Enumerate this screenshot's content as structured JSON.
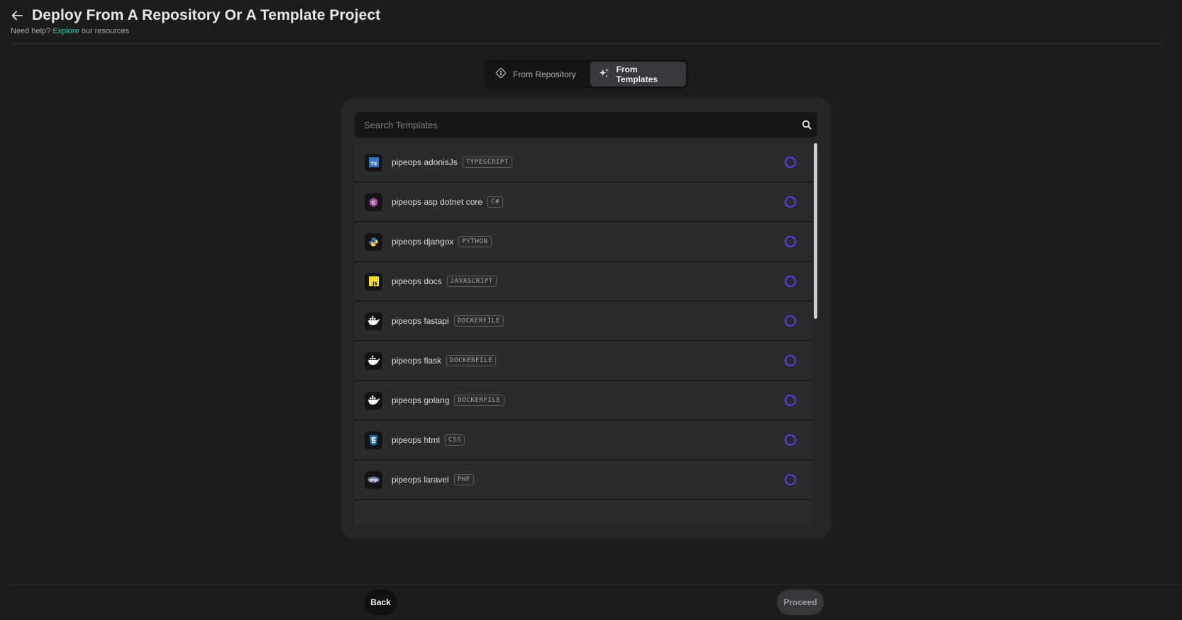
{
  "header": {
    "title": "Deploy From A Repository Or A Template Project",
    "help_prefix": "Need help?",
    "help_link": "Explore",
    "help_suffix": "our resources"
  },
  "tabs": {
    "repository": {
      "label": "From Repository",
      "icon": "git-icon"
    },
    "templates": {
      "label": "From Templates",
      "icon": "sparkles-icon",
      "selected": true
    }
  },
  "search": {
    "placeholder": "Search Templates",
    "value": "",
    "icon": "search-icon"
  },
  "templates": [
    {
      "name": "pipeops adonisJs",
      "tag": "TYPESCRIPT",
      "icon": "typescript-icon"
    },
    {
      "name": "pipeops asp dotnet core",
      "tag": "C#",
      "icon": "csharp-icon"
    },
    {
      "name": "pipeops djangox",
      "tag": "PYTHON",
      "icon": "python-icon"
    },
    {
      "name": "pipeops docs",
      "tag": "JAVASCRIPT",
      "icon": "javascript-icon"
    },
    {
      "name": "pipeops fastapi",
      "tag": "DOCKERFILE",
      "icon": "docker-icon"
    },
    {
      "name": "pipeops flask",
      "tag": "DOCKERFILE",
      "icon": "docker-icon"
    },
    {
      "name": "pipeops golang",
      "tag": "DOCKERFILE",
      "icon": "docker-icon"
    },
    {
      "name": "pipeops html",
      "tag": "CSS",
      "icon": "css3-icon"
    },
    {
      "name": "pipeops laravel",
      "tag": "PHP",
      "icon": "php-icon"
    }
  ],
  "footer": {
    "back_label": "Back",
    "proceed_label": "Proceed"
  },
  "colors": {
    "accent_radio": "#5b3ef2",
    "link": "#38c3a8",
    "background": "#1c1c1e"
  }
}
